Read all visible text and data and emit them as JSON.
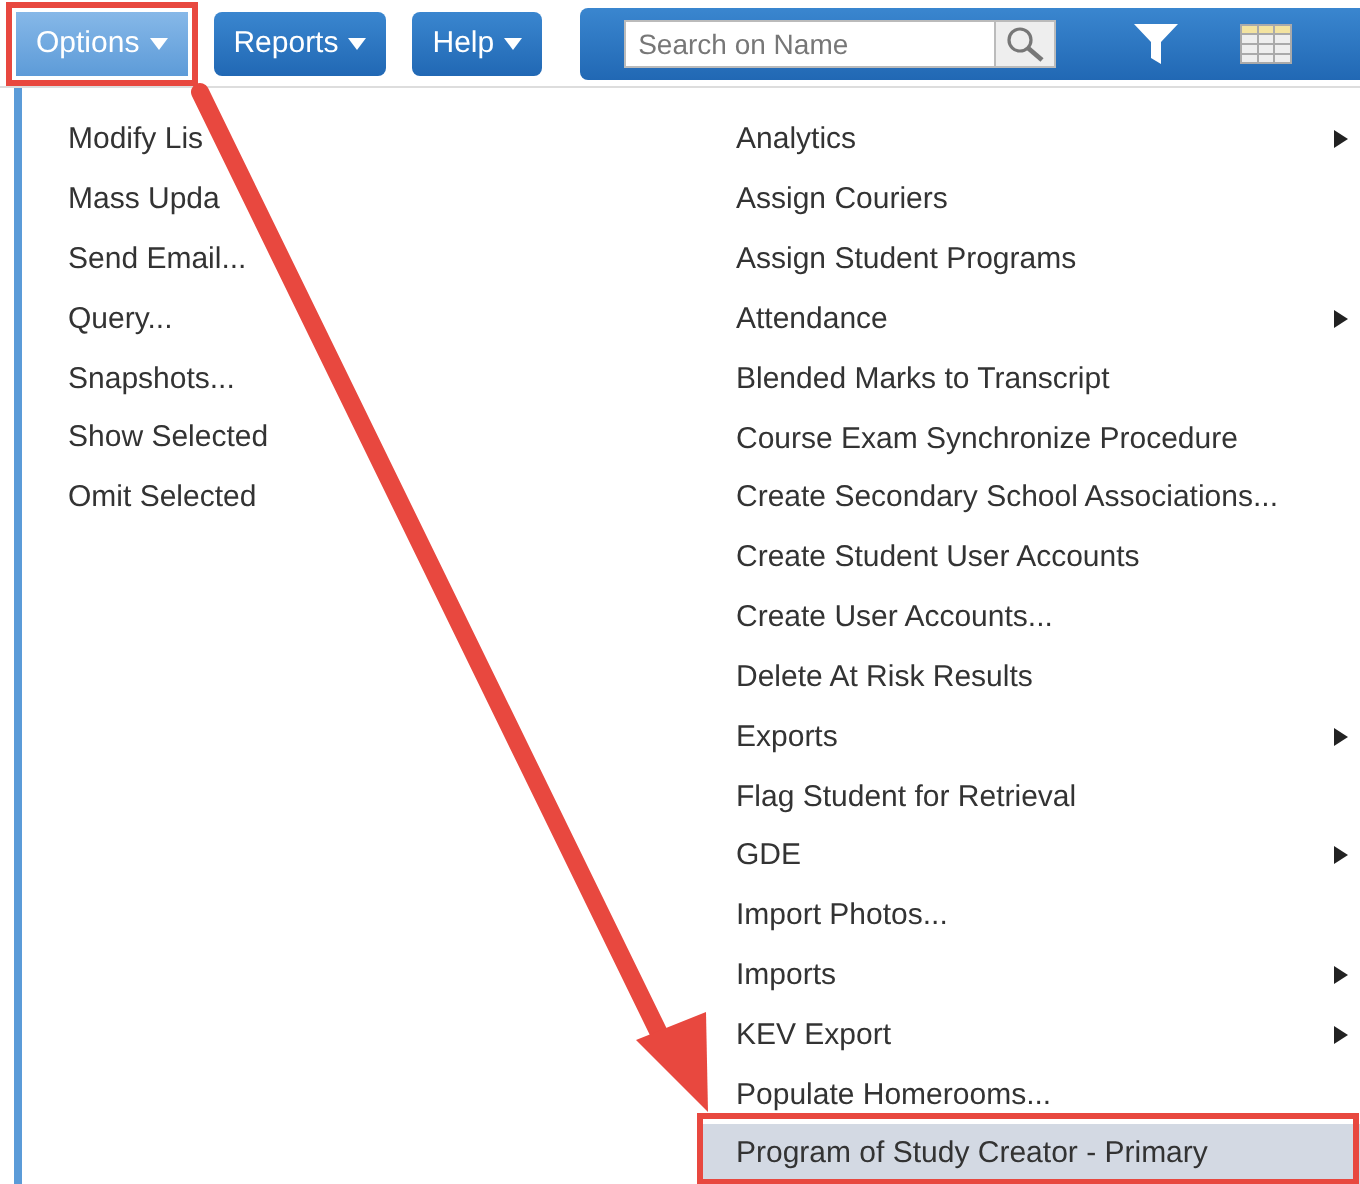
{
  "toolbar": {
    "menus": [
      {
        "label": "Options",
        "selected": true
      },
      {
        "label": "Reports",
        "selected": false
      },
      {
        "label": "Help",
        "selected": false
      }
    ],
    "search": {
      "placeholder": "Search on Name"
    }
  },
  "options_menu": {
    "items": [
      {
        "label": "Modify Lis"
      },
      {
        "label": "Mass Upda"
      },
      {
        "label": "Send Email..."
      },
      {
        "label": "Query..."
      },
      {
        "label": "Snapshots..."
      },
      {
        "label": "Show Selected"
      },
      {
        "label": "Omit Selected"
      }
    ]
  },
  "procedures_menu": {
    "items": [
      {
        "label": "Analytics",
        "submenu": true,
        "selected": false
      },
      {
        "label": "Assign Couriers",
        "submenu": false,
        "selected": false
      },
      {
        "label": "Assign Student Programs",
        "submenu": false,
        "selected": false
      },
      {
        "label": "Attendance",
        "submenu": true,
        "selected": false
      },
      {
        "label": "Blended Marks to Transcript",
        "submenu": false,
        "selected": false
      },
      {
        "label": "Course Exam Synchronize Procedure",
        "submenu": false,
        "selected": false
      },
      {
        "label": "Create Secondary School Associations...",
        "submenu": false,
        "selected": false
      },
      {
        "label": "Create Student User Accounts",
        "submenu": false,
        "selected": false
      },
      {
        "label": "Create User Accounts...",
        "submenu": false,
        "selected": false
      },
      {
        "label": "Delete At Risk Results",
        "submenu": false,
        "selected": false
      },
      {
        "label": "Exports",
        "submenu": true,
        "selected": false
      },
      {
        "label": "Flag Student for Retrieval",
        "submenu": false,
        "selected": false
      },
      {
        "label": "GDE",
        "submenu": true,
        "selected": false
      },
      {
        "label": "Import Photos...",
        "submenu": false,
        "selected": false
      },
      {
        "label": "Imports",
        "submenu": true,
        "selected": false
      },
      {
        "label": "KEV Export",
        "submenu": true,
        "selected": false
      },
      {
        "label": "Populate Homerooms...",
        "submenu": false,
        "selected": false
      },
      {
        "label": "Program of Study Creator - Primary",
        "submenu": false,
        "selected": true
      }
    ]
  }
}
